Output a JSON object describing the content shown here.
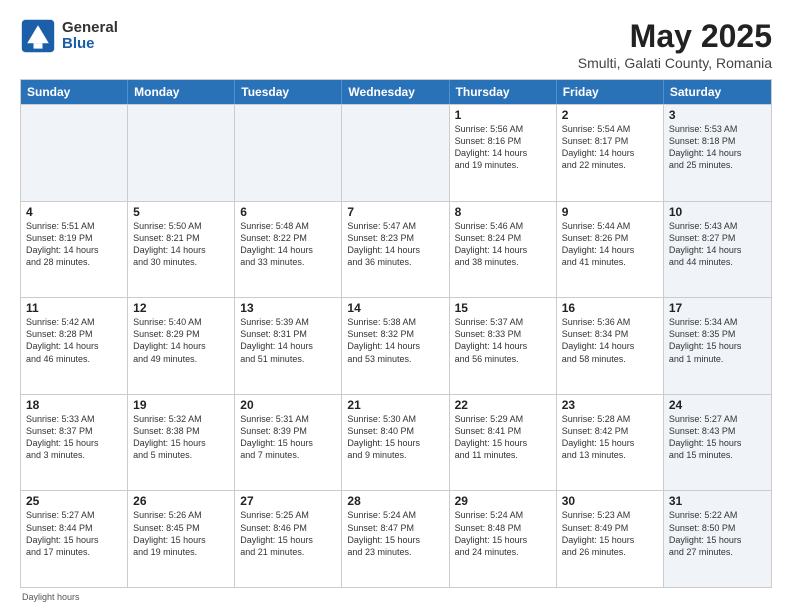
{
  "header": {
    "logo_general": "General",
    "logo_blue": "Blue",
    "main_title": "May 2025",
    "subtitle": "Smulti, Galati County, Romania"
  },
  "calendar": {
    "days_of_week": [
      "Sunday",
      "Monday",
      "Tuesday",
      "Wednesday",
      "Thursday",
      "Friday",
      "Saturday"
    ],
    "weeks": [
      [
        {
          "day": "",
          "info": "",
          "shaded": true
        },
        {
          "day": "",
          "info": "",
          "shaded": true
        },
        {
          "day": "",
          "info": "",
          "shaded": true
        },
        {
          "day": "",
          "info": "",
          "shaded": true
        },
        {
          "day": "1",
          "info": "Sunrise: 5:56 AM\nSunset: 8:16 PM\nDaylight: 14 hours\nand 19 minutes.",
          "shaded": false
        },
        {
          "day": "2",
          "info": "Sunrise: 5:54 AM\nSunset: 8:17 PM\nDaylight: 14 hours\nand 22 minutes.",
          "shaded": false
        },
        {
          "day": "3",
          "info": "Sunrise: 5:53 AM\nSunset: 8:18 PM\nDaylight: 14 hours\nand 25 minutes.",
          "shaded": true
        }
      ],
      [
        {
          "day": "4",
          "info": "Sunrise: 5:51 AM\nSunset: 8:19 PM\nDaylight: 14 hours\nand 28 minutes.",
          "shaded": false
        },
        {
          "day": "5",
          "info": "Sunrise: 5:50 AM\nSunset: 8:21 PM\nDaylight: 14 hours\nand 30 minutes.",
          "shaded": false
        },
        {
          "day": "6",
          "info": "Sunrise: 5:48 AM\nSunset: 8:22 PM\nDaylight: 14 hours\nand 33 minutes.",
          "shaded": false
        },
        {
          "day": "7",
          "info": "Sunrise: 5:47 AM\nSunset: 8:23 PM\nDaylight: 14 hours\nand 36 minutes.",
          "shaded": false
        },
        {
          "day": "8",
          "info": "Sunrise: 5:46 AM\nSunset: 8:24 PM\nDaylight: 14 hours\nand 38 minutes.",
          "shaded": false
        },
        {
          "day": "9",
          "info": "Sunrise: 5:44 AM\nSunset: 8:26 PM\nDaylight: 14 hours\nand 41 minutes.",
          "shaded": false
        },
        {
          "day": "10",
          "info": "Sunrise: 5:43 AM\nSunset: 8:27 PM\nDaylight: 14 hours\nand 44 minutes.",
          "shaded": true
        }
      ],
      [
        {
          "day": "11",
          "info": "Sunrise: 5:42 AM\nSunset: 8:28 PM\nDaylight: 14 hours\nand 46 minutes.",
          "shaded": false
        },
        {
          "day": "12",
          "info": "Sunrise: 5:40 AM\nSunset: 8:29 PM\nDaylight: 14 hours\nand 49 minutes.",
          "shaded": false
        },
        {
          "day": "13",
          "info": "Sunrise: 5:39 AM\nSunset: 8:31 PM\nDaylight: 14 hours\nand 51 minutes.",
          "shaded": false
        },
        {
          "day": "14",
          "info": "Sunrise: 5:38 AM\nSunset: 8:32 PM\nDaylight: 14 hours\nand 53 minutes.",
          "shaded": false
        },
        {
          "day": "15",
          "info": "Sunrise: 5:37 AM\nSunset: 8:33 PM\nDaylight: 14 hours\nand 56 minutes.",
          "shaded": false
        },
        {
          "day": "16",
          "info": "Sunrise: 5:36 AM\nSunset: 8:34 PM\nDaylight: 14 hours\nand 58 minutes.",
          "shaded": false
        },
        {
          "day": "17",
          "info": "Sunrise: 5:34 AM\nSunset: 8:35 PM\nDaylight: 15 hours\nand 1 minute.",
          "shaded": true
        }
      ],
      [
        {
          "day": "18",
          "info": "Sunrise: 5:33 AM\nSunset: 8:37 PM\nDaylight: 15 hours\nand 3 minutes.",
          "shaded": false
        },
        {
          "day": "19",
          "info": "Sunrise: 5:32 AM\nSunset: 8:38 PM\nDaylight: 15 hours\nand 5 minutes.",
          "shaded": false
        },
        {
          "day": "20",
          "info": "Sunrise: 5:31 AM\nSunset: 8:39 PM\nDaylight: 15 hours\nand 7 minutes.",
          "shaded": false
        },
        {
          "day": "21",
          "info": "Sunrise: 5:30 AM\nSunset: 8:40 PM\nDaylight: 15 hours\nand 9 minutes.",
          "shaded": false
        },
        {
          "day": "22",
          "info": "Sunrise: 5:29 AM\nSunset: 8:41 PM\nDaylight: 15 hours\nand 11 minutes.",
          "shaded": false
        },
        {
          "day": "23",
          "info": "Sunrise: 5:28 AM\nSunset: 8:42 PM\nDaylight: 15 hours\nand 13 minutes.",
          "shaded": false
        },
        {
          "day": "24",
          "info": "Sunrise: 5:27 AM\nSunset: 8:43 PM\nDaylight: 15 hours\nand 15 minutes.",
          "shaded": true
        }
      ],
      [
        {
          "day": "25",
          "info": "Sunrise: 5:27 AM\nSunset: 8:44 PM\nDaylight: 15 hours\nand 17 minutes.",
          "shaded": false
        },
        {
          "day": "26",
          "info": "Sunrise: 5:26 AM\nSunset: 8:45 PM\nDaylight: 15 hours\nand 19 minutes.",
          "shaded": false
        },
        {
          "day": "27",
          "info": "Sunrise: 5:25 AM\nSunset: 8:46 PM\nDaylight: 15 hours\nand 21 minutes.",
          "shaded": false
        },
        {
          "day": "28",
          "info": "Sunrise: 5:24 AM\nSunset: 8:47 PM\nDaylight: 15 hours\nand 23 minutes.",
          "shaded": false
        },
        {
          "day": "29",
          "info": "Sunrise: 5:24 AM\nSunset: 8:48 PM\nDaylight: 15 hours\nand 24 minutes.",
          "shaded": false
        },
        {
          "day": "30",
          "info": "Sunrise: 5:23 AM\nSunset: 8:49 PM\nDaylight: 15 hours\nand 26 minutes.",
          "shaded": false
        },
        {
          "day": "31",
          "info": "Sunrise: 5:22 AM\nSunset: 8:50 PM\nDaylight: 15 hours\nand 27 minutes.",
          "shaded": true
        }
      ]
    ]
  },
  "footer": {
    "note": "Daylight hours"
  }
}
